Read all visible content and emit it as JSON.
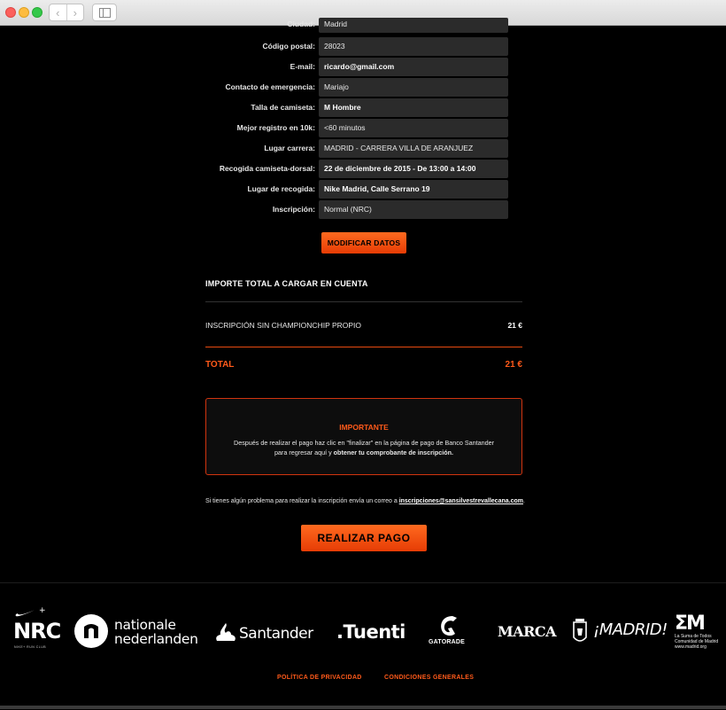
{
  "browser": {
    "back_icon": "chevron-left-icon",
    "forward_icon": "chevron-right-icon",
    "sidebar_icon": "sidebar-icon"
  },
  "form": {
    "rows": [
      {
        "label": "Ciudad:",
        "value": "Madrid"
      },
      {
        "label": "Código postal:",
        "value": "28023"
      },
      {
        "label": "E-mail:",
        "value": "ricardo@gmail.com"
      },
      {
        "label": "Contacto de emergencia:",
        "value": "Mariajo"
      },
      {
        "label": "Talla de camiseta:",
        "value": "M Hombre"
      },
      {
        "label": "Mejor registro en 10k:",
        "value": "<60 minutos"
      },
      {
        "label": "Lugar carrera:",
        "value": "MADRID - CARRERA VILLA DE ARANJUEZ"
      },
      {
        "label": "Recogida camiseta-dorsal:",
        "value": "22 de diciembre de 2015 - De 13:00 a 14:00"
      },
      {
        "label": "Lugar de recogida:",
        "value": "Nike Madrid, Calle Serrano 19"
      },
      {
        "label": "Inscripción:",
        "value": "Normal (NRC)"
      }
    ],
    "modify_button": "MODIFICAR DATOS"
  },
  "summary": {
    "title": "IMPORTE TOTAL A CARGAR EN CUENTA",
    "line_label": "INSCRIPCIÓN SIN CHAMPIONCHIP PROPIO",
    "line_amount": "21 €",
    "total_label": "TOTAL",
    "total_amount": "21 €"
  },
  "notice": {
    "title": "IMPORTANTE",
    "text_1": "Después de realizar el pago haz clic en \"finalizar\" en la página de pago de Banco Santander para regresar aquí y ",
    "text_bold": "obtener tu comprobante de inscripción."
  },
  "help": {
    "text": "Si tienes algún problema para realizar la inscripción envía un correo a ",
    "email": "inscripciones@sansilvestrevallecana.com",
    "end": "."
  },
  "pay_button": "REALIZAR PAGO",
  "sponsors": {
    "nrc": "NRC",
    "nrc_sub": "NIKE+ RUN CLUB",
    "nn_line1": "nationale",
    "nn_line2": "nederlanden",
    "santander": "Santander",
    "tuenti": ".Tuenti",
    "gatorade": "GATORADE",
    "marca": "MARCA",
    "madrid": "¡MADRID!",
    "em": "ΣM",
    "em_sub1": "La Suma de Todos",
    "em_sub2": "Comunidad de Madrid",
    "em_sub3": "www.madrid.org"
  },
  "footer": {
    "privacy": "POLÍTICA DE PRIVACIDAD",
    "conditions": "CONDICIONES GENERALES"
  }
}
